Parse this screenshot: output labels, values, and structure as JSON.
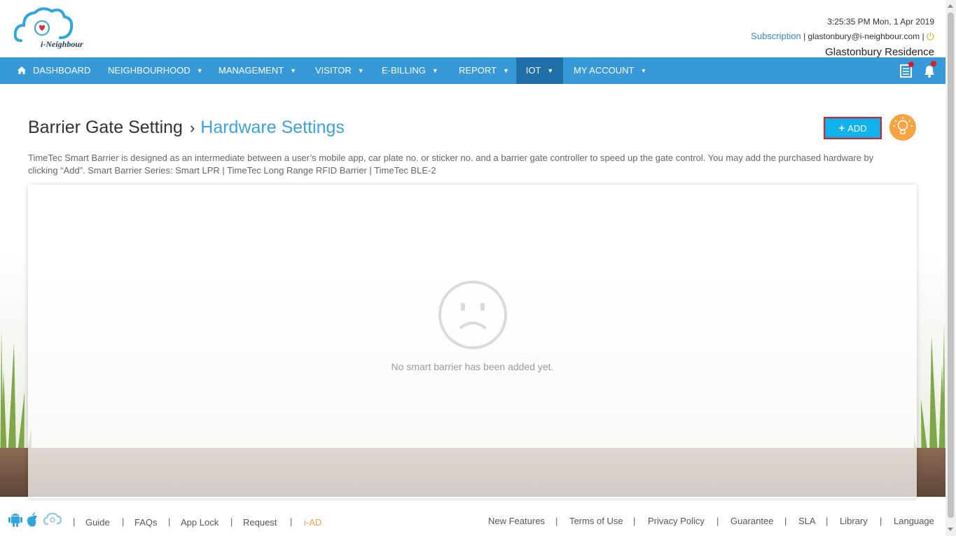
{
  "header": {
    "logo_text": "i-Neighbour",
    "datetime": "3:25:35 PM  Mon, 1 Apr 2019",
    "subscription_label": "Subscription",
    "email": "glastonbury@i-neighbour.com",
    "residence": "Glastonbury Residence"
  },
  "nav": {
    "items": [
      {
        "label": "DASHBOARD"
      },
      {
        "label": "NEIGHBOURHOOD"
      },
      {
        "label": "MANAGEMENT"
      },
      {
        "label": "VISITOR"
      },
      {
        "label": "E-BILLING"
      },
      {
        "label": "REPORT"
      },
      {
        "label": "IOT"
      },
      {
        "label": "MY ACCOUNT"
      }
    ],
    "active": "IOT"
  },
  "page": {
    "breadcrumb_parent": "Barrier Gate Setting",
    "breadcrumb_current": "Hardware Settings",
    "add_label": "ADD",
    "description": "TimeTec Smart Barrier is designed as an intermediate between a user’s mobile app, car plate no. or sticker no. and a barrier gate controller to speed up the gate control. You may add the purchased hardware by clicking “Add”. Smart Barrier Series: Smart LPR | TimeTec Long Range RFID Barrier | TimeTec BLE-2",
    "empty_message": "No smart barrier has been added yet."
  },
  "footer": {
    "left_links": [
      "Guide",
      "FAQs",
      "App Lock",
      "Request",
      "i-AD"
    ],
    "right_links": [
      "New Features",
      "Terms of Use",
      "Privacy Policy",
      "Guarantee",
      "SLA",
      "Library",
      "Language"
    ]
  },
  "colors": {
    "nav_bg": "#3799d8",
    "nav_active": "#1f6fa8",
    "accent_link": "#3ba3dd",
    "add_button": "#0faee8",
    "add_button_border": "#e01b24",
    "bulb": "#f7a440",
    "iad_link": "#f0a040"
  }
}
